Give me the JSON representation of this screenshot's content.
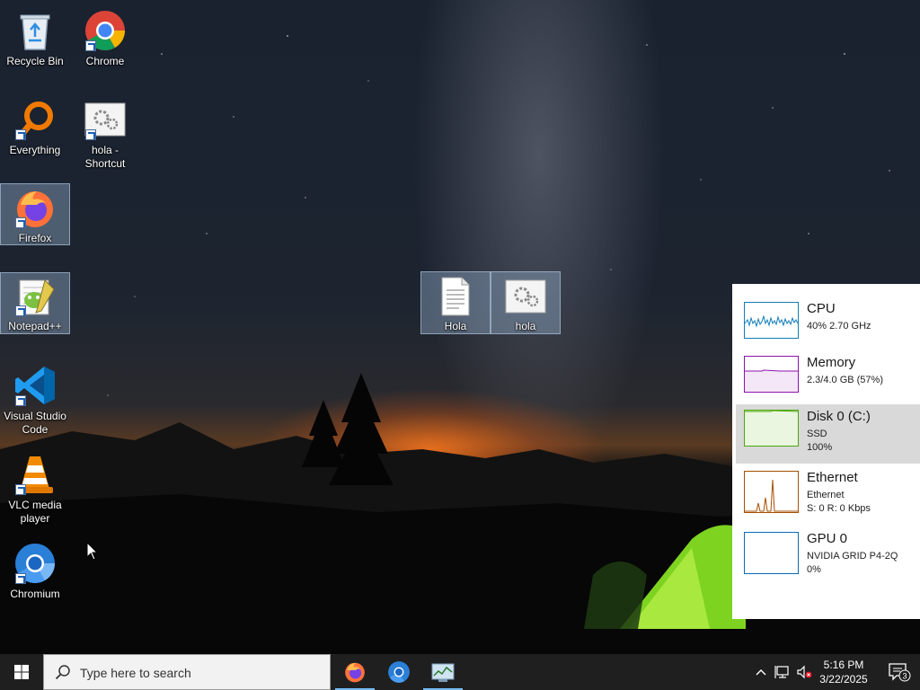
{
  "desktop": {
    "icons": [
      {
        "label": "Recycle Bin"
      },
      {
        "label": "Chrome"
      },
      {
        "label": "Everything"
      },
      {
        "label": "hola -\nShortcut"
      },
      {
        "label": "Firefox"
      },
      {
        "label": "Notepad++"
      },
      {
        "label": "Visual Studio\nCode"
      },
      {
        "label": "VLC media\nplayer"
      },
      {
        "label": "Chromium"
      },
      {
        "label": "Hola"
      },
      {
        "label": "hola"
      }
    ]
  },
  "perf_panel": {
    "items": [
      {
        "title": "CPU",
        "line1": "40%  2.70 GHz",
        "line2": "",
        "color": "#117dbb"
      },
      {
        "title": "Memory",
        "line1": "2.3/4.0 GB (57%)",
        "line2": "",
        "color": "#8b12ae"
      },
      {
        "title": "Disk 0 (C:)",
        "line1": "SSD",
        "line2": "100%",
        "color": "#4da60c"
      },
      {
        "title": "Ethernet",
        "line1": "Ethernet",
        "line2": "S: 0 R: 0 Kbps",
        "color": "#a74f01"
      },
      {
        "title": "GPU 0",
        "line1": "NVIDIA GRID P4-2Q",
        "line2": "0%",
        "color": "#0a6ab5"
      }
    ]
  },
  "taskbar": {
    "search_placeholder": "Type here to search",
    "apps": [
      {
        "icon": "firefox-icon",
        "active": true
      },
      {
        "icon": "chromium-icon",
        "active": false
      },
      {
        "icon": "task-manager-icon",
        "active": true
      }
    ],
    "clock": {
      "time": "5:16 PM",
      "date": "3/22/2025"
    },
    "notification_count": "3"
  }
}
